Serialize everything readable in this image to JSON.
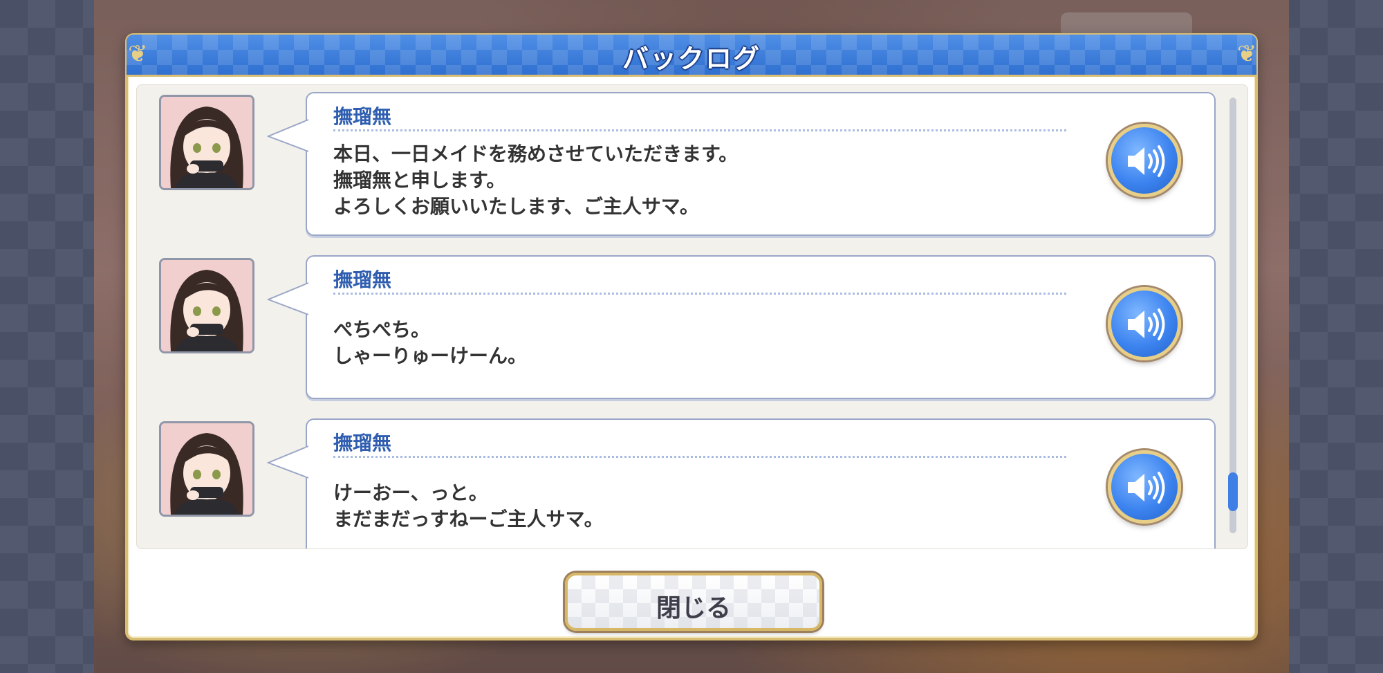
{
  "window": {
    "title": "バックログ"
  },
  "log": {
    "entries": [
      {
        "speaker": "撫瑠無",
        "lines": [
          "本日、一日メイドを務めさせていただきます。",
          "撫瑠無と申します。",
          "よろしくお願いいたします、ご主人サマ。"
        ]
      },
      {
        "speaker": "撫瑠無",
        "lines": [
          "ぺちぺち。",
          "しゃーりゅーけーん。"
        ]
      },
      {
        "speaker": "撫瑠無",
        "lines": [
          "けーおー、っと。",
          "まだまだっすねーご主人サマ。"
        ]
      }
    ],
    "voice_icon": "speaker-volume-icon",
    "scroll_position": 0.92
  },
  "footer": {
    "close_label": "閉じる"
  },
  "colors": {
    "title_bar": "#3b7bdc",
    "gold_border": "#d9bd73",
    "speaker_name": "#2f5eb0",
    "voice_button": "#3d84f0"
  }
}
